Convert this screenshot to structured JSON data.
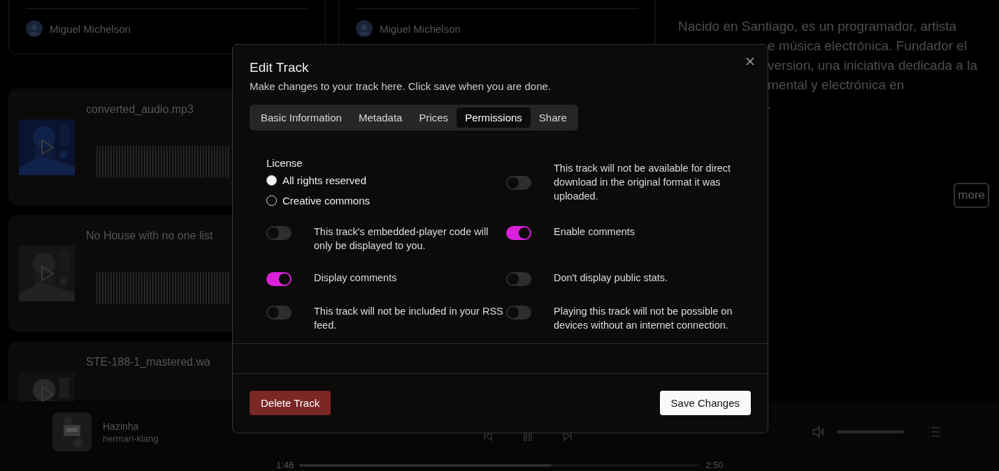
{
  "background": {
    "author_cards": [
      {
        "author": "Miguel Michelson"
      },
      {
        "author": "Miguel Michelson"
      }
    ],
    "tracks": [
      {
        "title": "converted_audio.mp3"
      },
      {
        "title": "No House with no one list"
      },
      {
        "title": "STE-188-1_mastered.wa"
      }
    ],
    "bio": [
      "Nacido en Santiago, es un programador, artista",
      "e música electrónica. Fundador el",
      "version, una iniciativa dedicada a la",
      "mental y electrónica en",
      "."
    ],
    "more_button": "more"
  },
  "player": {
    "title": "Hazinha",
    "artist": "herman-klang",
    "elapsed": "1:46",
    "duration": "2:50",
    "progress": {
      "level": 0.63
    },
    "volume": {
      "level": 1
    }
  },
  "dialog": {
    "title": "Edit Track",
    "description": "Make changes to your track here. Click save when you are done.",
    "tabs": [
      {
        "label": "Basic Information",
        "selected": false
      },
      {
        "label": "Metadata",
        "selected": false
      },
      {
        "label": "Prices",
        "selected": false
      },
      {
        "label": "Permissions",
        "selected": true
      },
      {
        "label": "Share",
        "selected": false
      }
    ],
    "license": {
      "label": "License",
      "options": [
        {
          "label": "All rights reserved",
          "selected": true
        },
        {
          "label": "Creative commons",
          "selected": false
        }
      ]
    },
    "permissions": [
      {
        "text": "This track will not be available for direct download in the original format it was uploaded.",
        "on": false
      },
      {
        "text": "This track's embedded-player code will only be displayed to you.",
        "on": false
      },
      {
        "text": "Enable comments",
        "on": true
      },
      {
        "text": "Display comments",
        "on": true
      },
      {
        "text": "Don't display public stats.",
        "on": false
      },
      {
        "text": "This track will not be included in your RSS feed.",
        "on": false
      },
      {
        "text": "Playing this track will not be possible on devices without an internet connection.",
        "on": false
      }
    ],
    "delete_button": "Delete Track",
    "save_button": "Save Changes"
  }
}
